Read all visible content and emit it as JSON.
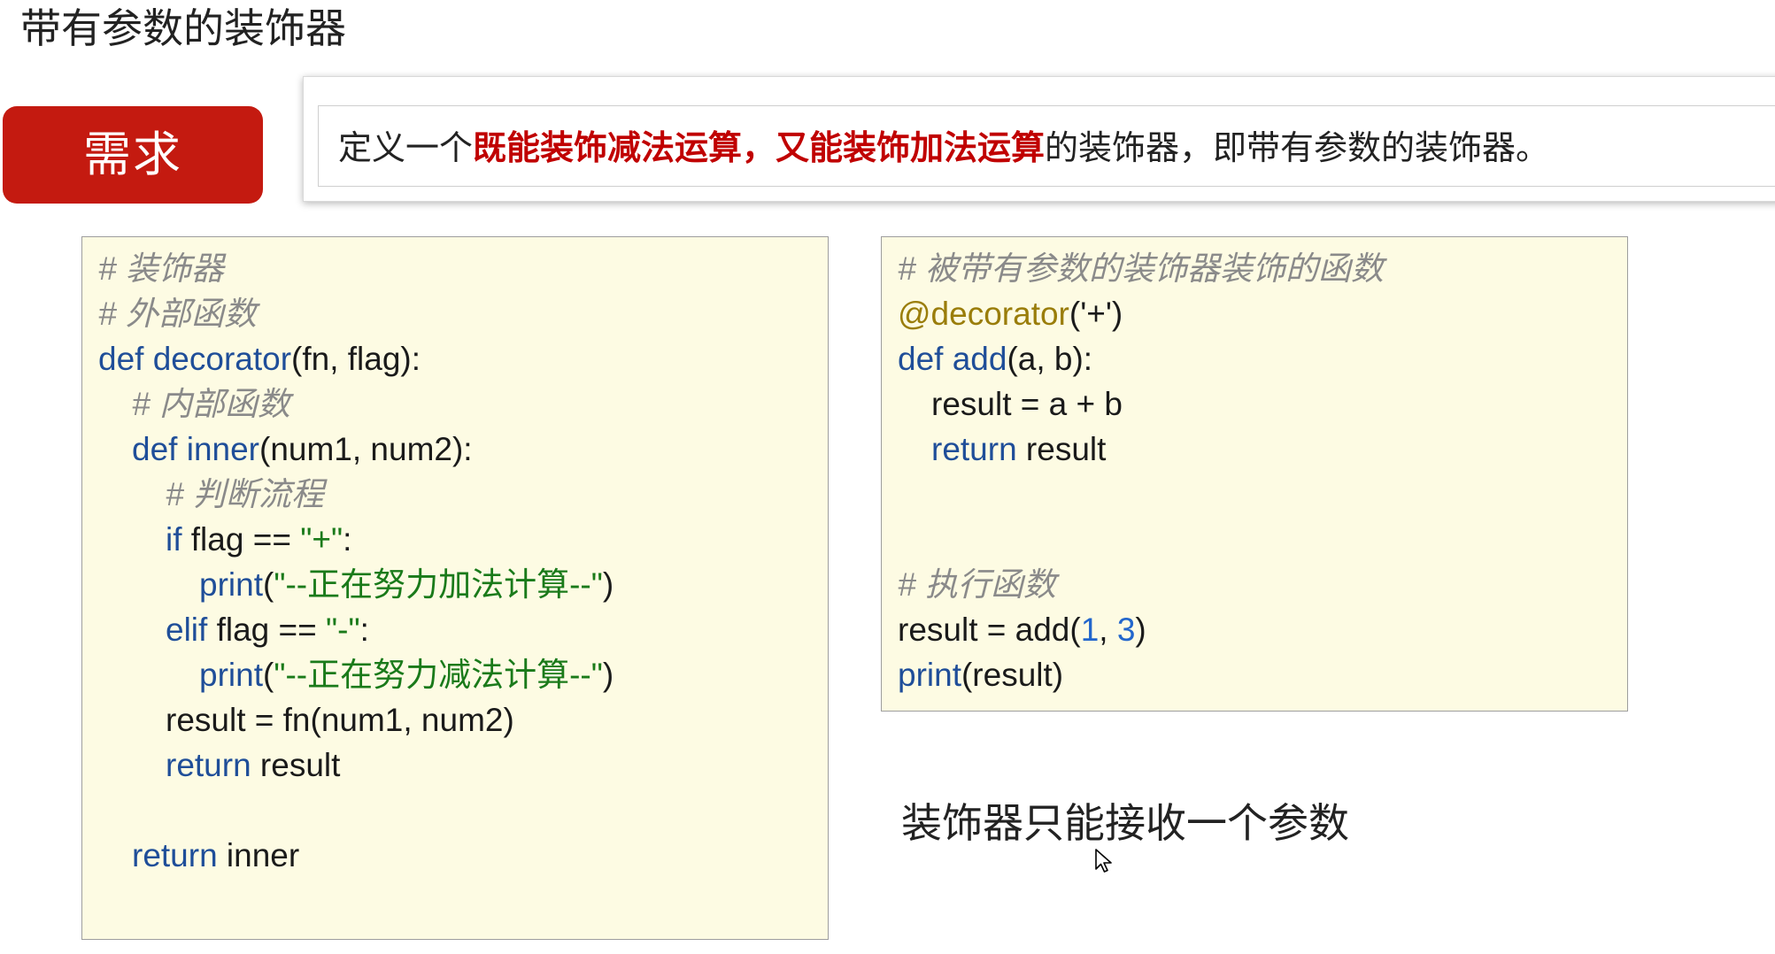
{
  "page": {
    "title": "带有参数的装饰器"
  },
  "requirement": {
    "badge_label": "需求",
    "text_before": "定义一个",
    "text_highlight": "既能装饰减法运算，又能装饰加法运算",
    "text_after": "的装饰器，即带有参数的装饰器。",
    "highlight_color": "#c00000",
    "badge_color": "#c41a10"
  },
  "code_left": {
    "background": "#fdfbe3",
    "lines": {
      "l1": "# 装饰器",
      "l2": "# 外部函数",
      "l3_kw": "def",
      "l3_fn": "decorator",
      "l3_rest": "(fn, flag):",
      "l4": "# 内部函数",
      "l5_kw": "def",
      "l5_fn": "inner",
      "l5_rest": "(num1, num2):",
      "l6": "# 判断流程",
      "l7_kw": "if",
      "l7_mid": " flag == ",
      "l7_str": "\"+\"",
      "l7_end": ":",
      "l8_fn": "print",
      "l8_open": "(",
      "l8_str": "\"--正在努力加法计算--\"",
      "l8_close": ")",
      "l9_kw": "elif",
      "l9_mid": " flag == ",
      "l9_str": "\"-\"",
      "l9_end": ":",
      "l10_fn": "print",
      "l10_open": "(",
      "l10_str": "\"--正在努力减法计算--\"",
      "l10_close": ")",
      "l11": "result = fn(num1, num2)",
      "l12_kw": "return",
      "l12_rest": " result",
      "l13_kw": "return",
      "l13_rest": " inner"
    }
  },
  "code_right": {
    "background": "#fdfbe3",
    "lines": {
      "r1": "# 被带有参数的装饰器装饰的函数",
      "r2_deco": "@decorator",
      "r2_rest": "('+')",
      "r3_kw": "def",
      "r3_fn": "add",
      "r3_rest": "(a, b):",
      "r4": "result = a + b",
      "r5_kw": "return",
      "r5_rest": " result",
      "r6": "# 执行函数",
      "r7_a": "result = add(",
      "r7_n1": "1",
      "r7_b": ", ",
      "r7_n2": "3",
      "r7_c": ")",
      "r8_fn": "print",
      "r8_rest": "(result)"
    }
  },
  "note": {
    "text": "装饰器只能接收一个参数"
  }
}
